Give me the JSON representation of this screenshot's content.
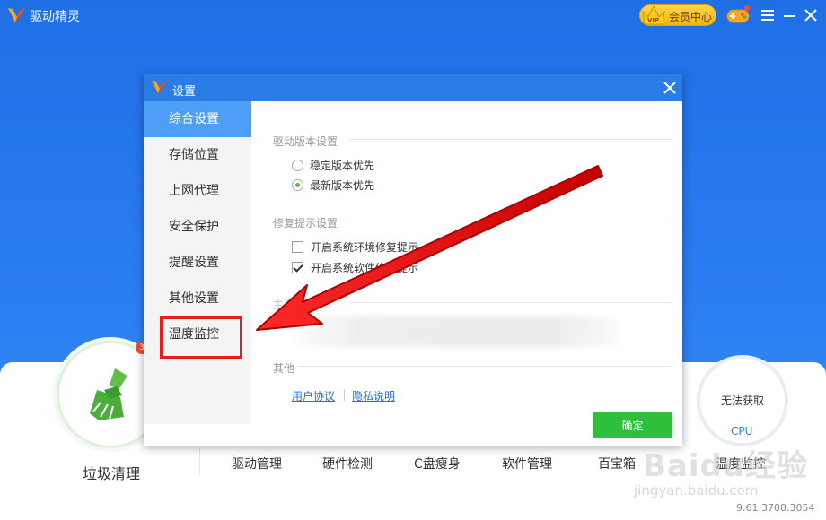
{
  "app": {
    "title": "驱动精灵",
    "vip_label": "会员中心",
    "vip_tag": "VIP",
    "version": "9.61.3708.3054"
  },
  "colors": {
    "brand_blue": "#2a7df0",
    "dialog_title": "#2a7de6",
    "active_menu": "#4d9ef6",
    "confirm_green": "#2fbf3a",
    "highlight_red": "#e61e1e"
  },
  "icons": [
    "app-logo-icon",
    "vip-crown-icon",
    "game-controller-icon",
    "menu-icon",
    "minimize-icon",
    "close-icon",
    "broom-icon"
  ],
  "main": {
    "clean_label": "垃圾清理",
    "clean_badge": "3",
    "nav": [
      {
        "label": "驱动管理"
      },
      {
        "label": "硬件检测"
      },
      {
        "label": "C盘瘦身"
      },
      {
        "label": "软件管理"
      },
      {
        "label": "百宝箱"
      },
      {
        "label": "温度监控"
      }
    ],
    "cpu_status": "无法获取",
    "cpu_label": "CPU"
  },
  "watermark": {
    "text": "Baidu经验",
    "sub": "jingyan.baidu.com"
  },
  "dialog": {
    "title": "设置",
    "menu": [
      {
        "label": "综合设置",
        "active": true
      },
      {
        "label": "存储位置",
        "active": false
      },
      {
        "label": "上网代理",
        "active": false
      },
      {
        "label": "安全保护",
        "active": false
      },
      {
        "label": "提醒设置",
        "active": false
      },
      {
        "label": "其他设置",
        "active": false
      },
      {
        "label": "温度监控",
        "active": false
      }
    ],
    "sections": {
      "version": {
        "title": "驱动版本设置",
        "options": [
          {
            "label": "稳定版本优先",
            "checked": false
          },
          {
            "label": "最新版本优先",
            "checked": true
          }
        ]
      },
      "repair": {
        "title": "修复提示设置",
        "options": [
          {
            "label": "开启系统环境修复提示",
            "checked": false
          },
          {
            "label": "开启系统软件修复提示",
            "checked": true
          }
        ]
      },
      "homepage": {
        "title": "主页保护"
      },
      "other": {
        "title": "其他",
        "links": [
          {
            "label": "用户协议"
          },
          {
            "label": "隐私说明"
          }
        ]
      }
    },
    "confirm_label": "确定"
  }
}
